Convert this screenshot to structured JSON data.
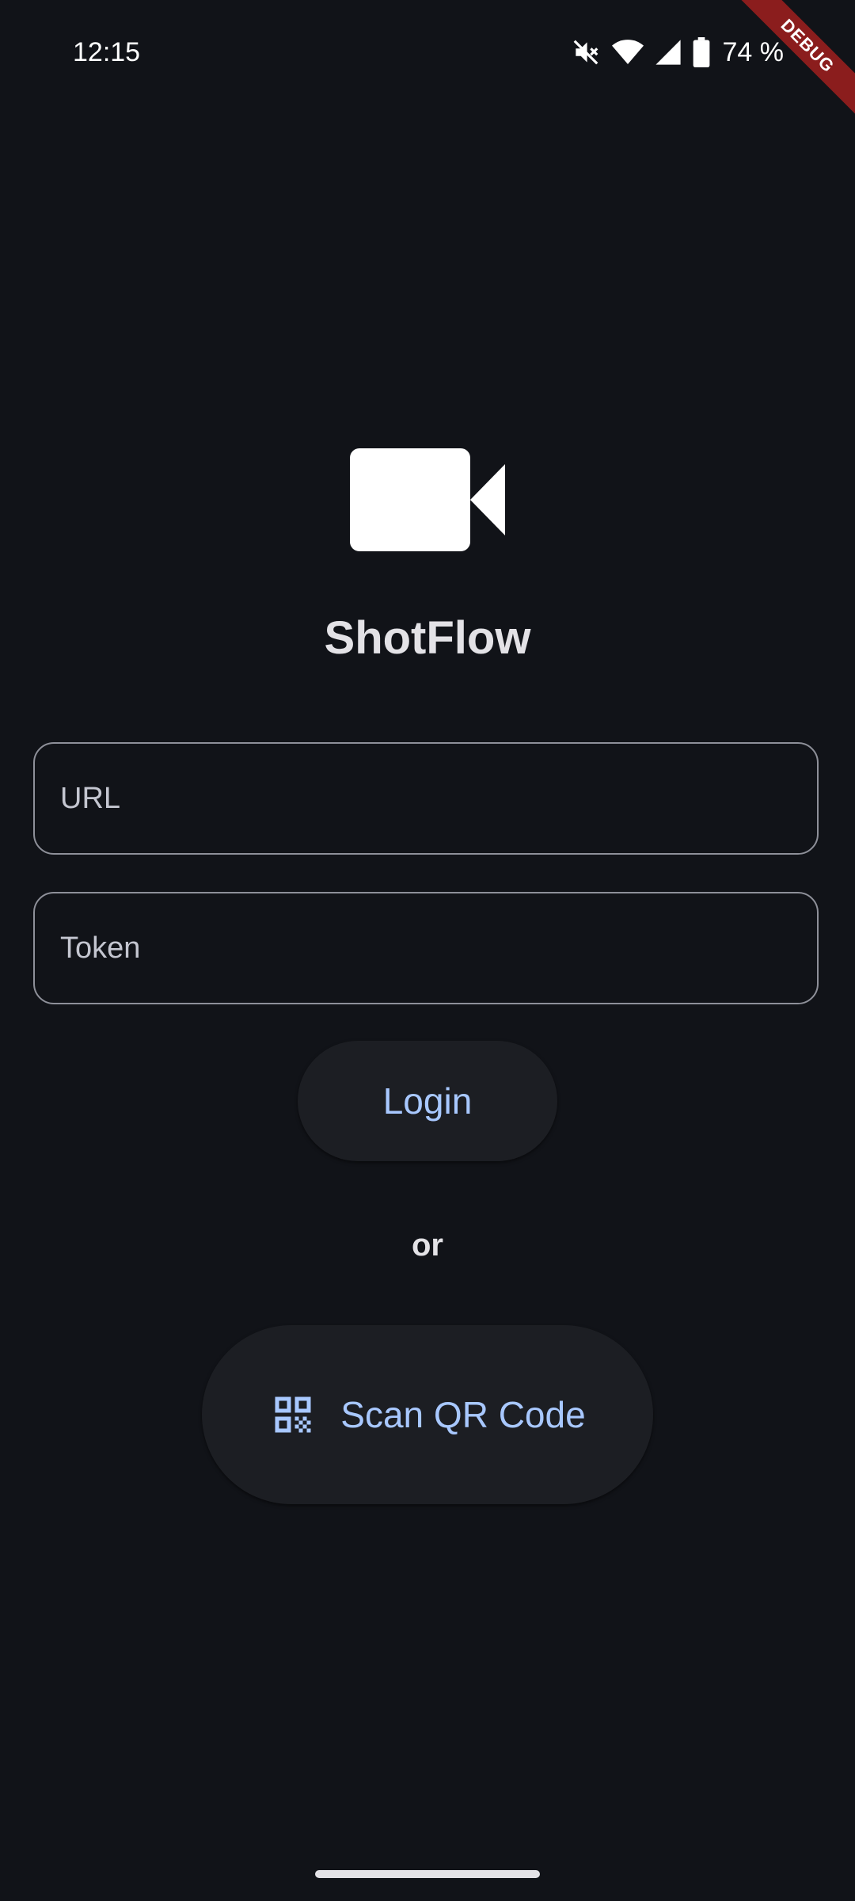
{
  "status_bar": {
    "time": "12:15",
    "battery_percent": "74 %",
    "icons": [
      "mute-icon",
      "wifi-icon",
      "signal-icon",
      "battery-icon"
    ]
  },
  "debug_banner": {
    "label": "DEBUG"
  },
  "app": {
    "logo_icon": "video-camera-icon",
    "title": "ShotFlow"
  },
  "form": {
    "url_placeholder": "URL",
    "url_value": "",
    "token_placeholder": "Token",
    "token_value": "",
    "login_label": "Login",
    "or_label": "or",
    "scan_label": "Scan QR Code",
    "scan_icon": "qr-code-icon"
  },
  "colors": {
    "background": "#111318",
    "accent": "#a8c8ff",
    "button_surface": "#1c1e23",
    "debug_red": "#8b1d1d"
  }
}
